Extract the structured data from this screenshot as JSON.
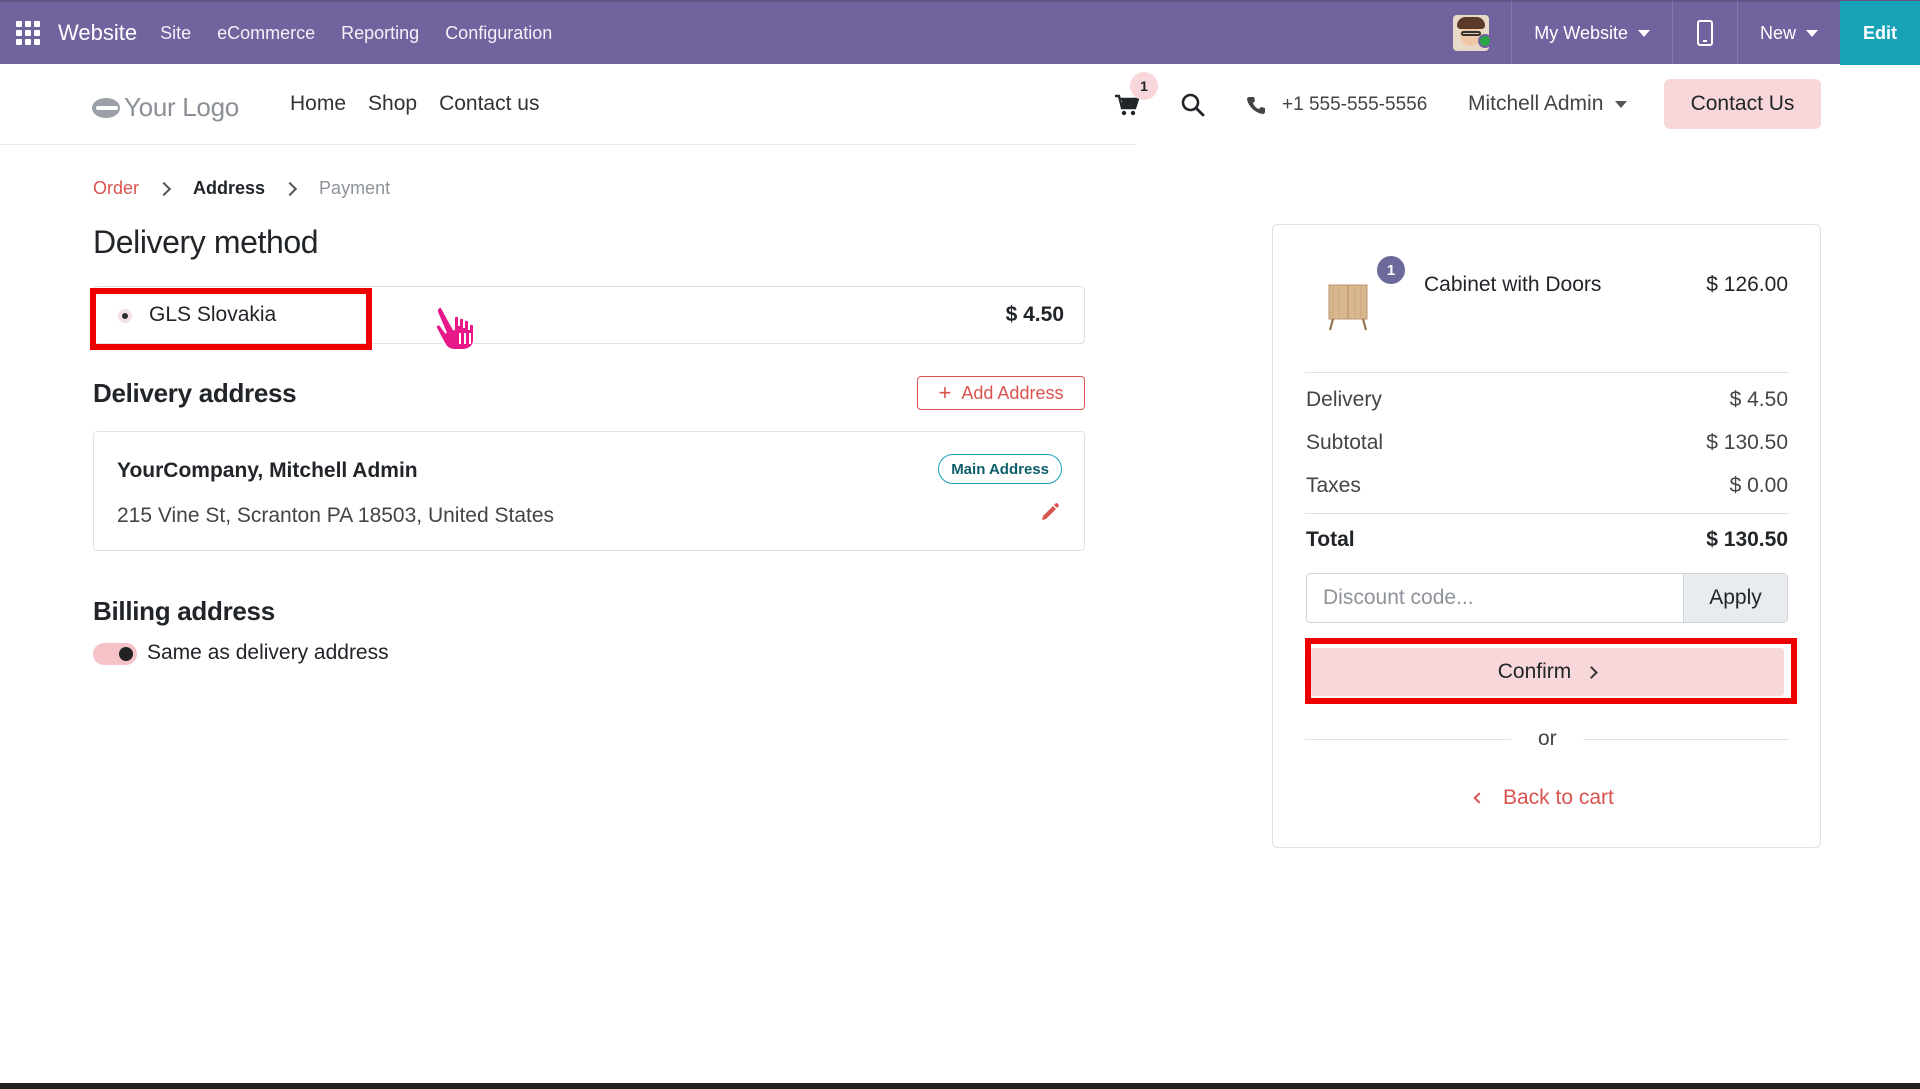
{
  "admin_bar": {
    "brand": "Website",
    "menu": [
      "Site",
      "eCommerce",
      "Reporting",
      "Configuration"
    ],
    "website_selector": "My Website",
    "new_label": "New",
    "edit_label": "Edit"
  },
  "header": {
    "logo_text": "Your Logo",
    "nav": [
      "Home",
      "Shop",
      "Contact us"
    ],
    "cart_count": "1",
    "phone": "+1 555-555-5556",
    "user": "Mitchell Admin",
    "contact_button": "Contact Us"
  },
  "breadcrumb": {
    "order": "Order",
    "address": "Address",
    "payment": "Payment"
  },
  "delivery_method": {
    "title": "Delivery method",
    "carrier": {
      "name": "GLS Slovakia",
      "price": "$ 4.50",
      "selected": true
    }
  },
  "delivery_address": {
    "title": "Delivery address",
    "add_button": "Add Address",
    "card": {
      "name": "YourCompany, Mitchell Admin",
      "address": "215 Vine St, Scranton PA 18503, United States",
      "badge": "Main Address"
    }
  },
  "billing": {
    "title": "Billing address",
    "same_as_label": "Same as delivery address",
    "same_as_enabled": true
  },
  "summary": {
    "product": {
      "name": "Cabinet with Doors",
      "price": "$ 126.00",
      "qty": "1"
    },
    "rows": {
      "delivery_label": "Delivery",
      "delivery_value": "$ 4.50",
      "subtotal_label": "Subtotal",
      "subtotal_value": "$ 130.50",
      "taxes_label": "Taxes",
      "taxes_value": "$ 0.00",
      "total_label": "Total",
      "total_value": "$ 130.50"
    },
    "discount_placeholder": "Discount code...",
    "apply_label": "Apply",
    "confirm_label": "Confirm",
    "or_label": "or",
    "back_label": "Back to cart"
  },
  "colors": {
    "admin_bar": "#71639e",
    "edit_button": "#17a2b8",
    "accent": "#d9534f",
    "pink_button": "#f8d7da",
    "highlight": "#ee0000"
  }
}
